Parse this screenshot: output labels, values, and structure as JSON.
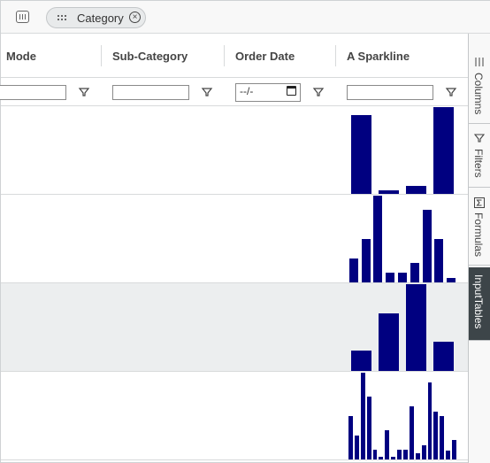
{
  "group_panel": {
    "icon": "group-panel-icon",
    "chips": [
      {
        "label": "Category",
        "icon": "drag-grip-icon",
        "remove_icon": "remove-circle-x-icon"
      }
    ]
  },
  "columns": [
    {
      "label": "Mode"
    },
    {
      "label": "Sub-Category"
    },
    {
      "label": "Order Date"
    },
    {
      "label": "A Sparkline"
    }
  ],
  "filters": {
    "mode_value": "",
    "subcategory_value": "",
    "order_date_placeholder": "--/-",
    "sparkline_value": "",
    "filter_icon": "funnel-icon",
    "calendar_icon": "calendar-icon"
  },
  "rows": [
    {
      "sparkline": [
        30,
        1.5,
        3,
        33
      ]
    },
    {
      "sparkline": [
        5,
        9,
        18,
        2,
        2,
        4,
        15,
        9,
        1
      ]
    },
    {
      "sparkline": [
        1.1,
        3.1,
        4.7,
        1.6
      ]
    },
    {
      "sparkline": [
        9,
        5,
        18,
        13,
        2,
        0.6,
        6,
        0.6,
        2,
        2,
        11,
        1.2,
        3,
        16,
        10,
        9,
        1.9,
        4
      ]
    }
  ],
  "selected_row_index": 2,
  "bar_color": "#000080",
  "side_panel": {
    "tabs": [
      {
        "label": "Columns",
        "icon": "columns-icon",
        "active": false
      },
      {
        "label": "Filters",
        "icon": "filter-icon",
        "active": false
      },
      {
        "label": "Formulas",
        "icon": "sigma-icon",
        "active": false
      },
      {
        "label": "InputTables",
        "active": true
      }
    ]
  }
}
